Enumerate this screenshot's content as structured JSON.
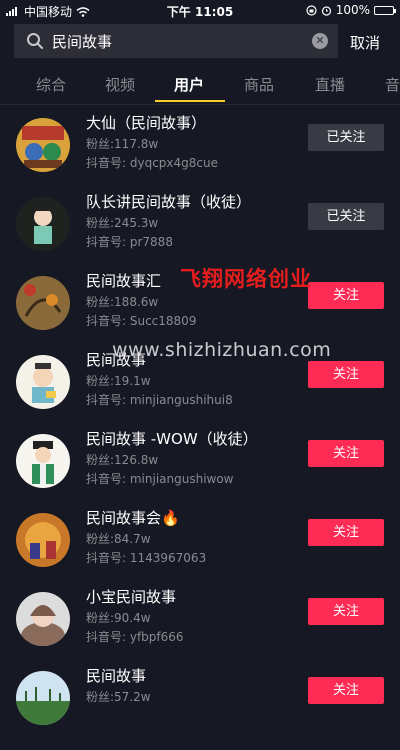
{
  "status_bar": {
    "carrier": "中国移动",
    "time": "下午 11:05",
    "battery_percent": "100%",
    "icons": [
      "signal-icon",
      "wifi-icon",
      "rotation-lock-icon",
      "alarm-icon",
      "battery-icon"
    ]
  },
  "search": {
    "query": "民间故事",
    "cancel_label": "取消"
  },
  "tabs": [
    {
      "label": "综合",
      "active": false
    },
    {
      "label": "视频",
      "active": false
    },
    {
      "label": "用户",
      "active": true
    },
    {
      "label": "商品",
      "active": false
    },
    {
      "label": "直播",
      "active": false
    },
    {
      "label": "音",
      "active": false
    }
  ],
  "users": [
    {
      "name": "大仙（民间故事）",
      "fans": "粉丝:117.8w",
      "dyid": "抖音号: dyqcpx4g8cue",
      "button": "已关注",
      "followed": true
    },
    {
      "name": "队长讲民间故事（收徒）",
      "fans": "粉丝:245.3w",
      "dyid": "抖音号: pr7888",
      "button": "已关注",
      "followed": true
    },
    {
      "name": "民间故事汇",
      "fans": "粉丝:188.6w",
      "dyid": "抖音号: Succ18809",
      "button": "关注",
      "followed": false
    },
    {
      "name": "民间故事",
      "fans": "粉丝:19.1w",
      "dyid": "抖音号: minjiangushihui8",
      "button": "关注",
      "followed": false
    },
    {
      "name": "民间故事 -WOW（收徒）",
      "fans": "粉丝:126.8w",
      "dyid": "抖音号: minjiangushiwow",
      "button": "关注",
      "followed": false
    },
    {
      "name": "民间故事会🔥",
      "fans": "粉丝:84.7w",
      "dyid": "抖音号: 1143967063",
      "button": "关注",
      "followed": false
    },
    {
      "name": "小宝民间故事",
      "fans": "粉丝:90.4w",
      "dyid": "抖音号: yfbpf666",
      "button": "关注",
      "followed": false
    },
    {
      "name": "民间故事",
      "fans": "粉丝:57.2w",
      "dyid": "",
      "button": "关注",
      "followed": false
    }
  ],
  "watermark": {
    "text_red": "飞翔网络创业",
    "text_url": "www.shizhizhuan.com"
  },
  "colors": {
    "background": "#161823",
    "follow_button": "#fe2c55",
    "followed_button": "#393b44",
    "tab_indicator": "#facd2f"
  }
}
